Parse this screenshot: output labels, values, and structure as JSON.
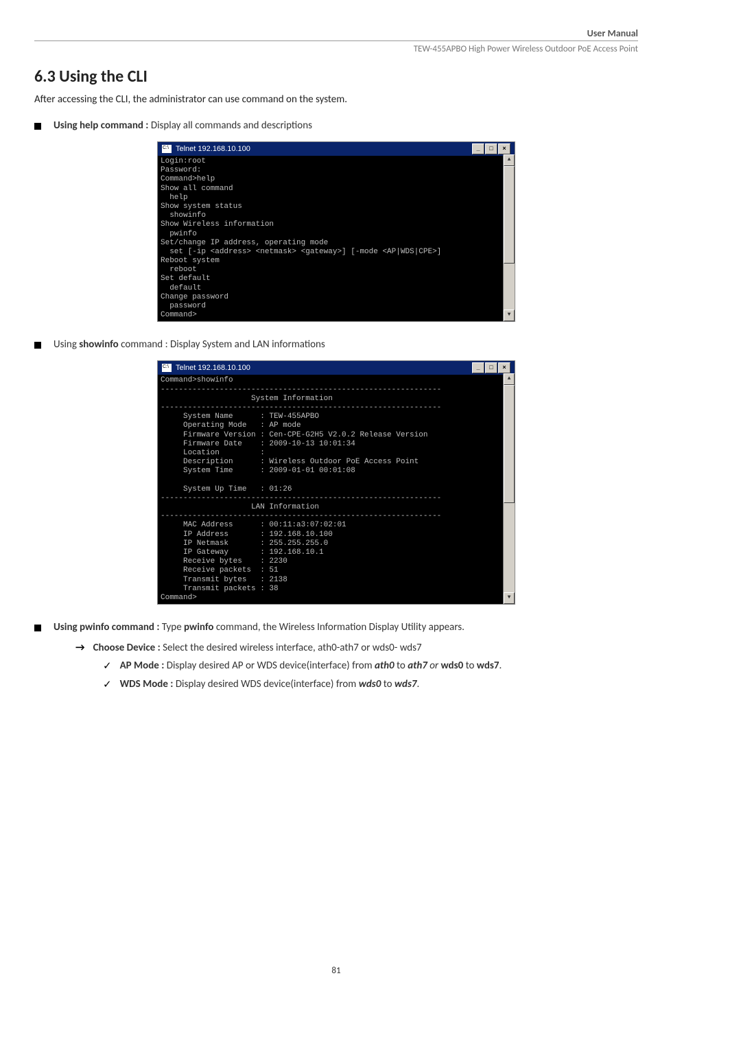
{
  "header": {
    "label": "User Manual",
    "subtitle": "TEW-455APBO High Power Wireless Outdoor PoE Access Point"
  },
  "section": {
    "number_title": "6.3 Using the CLI",
    "intro": "After accessing the CLI, the administrator can use command on the system."
  },
  "bullets": [
    {
      "bold": "Using help command :",
      "rest": " Display all commands and descriptions"
    },
    {
      "pre": "Using ",
      "bold": "showinfo",
      "rest": " command : Display System and LAN informations"
    },
    {
      "bold": "Using pwinfo command :",
      "mid": " Type ",
      "bold2": "pwinfo",
      "rest": " command, the Wireless Information Display Utility appears."
    }
  ],
  "arrow": {
    "bold": "Choose Device :",
    "rest": " Select the desired wireless interface, ath0-ath7 or wds0- wds7"
  },
  "checks": [
    {
      "bold": "AP Mode :",
      "t1": " Display desired AP or WDS device(interface) from ",
      "i1": "ath0",
      "t2": " to ",
      "i2": "ath7",
      "t3": " or ",
      "b2": "wds0",
      "t4": " to ",
      "b3": "wds7",
      "t5": "."
    },
    {
      "bold": "WDS Mode :",
      "t1": " Display desired WDS device(interface) from ",
      "i1": "wds0",
      "t2": " to ",
      "i2": "wds7",
      "t3": "."
    }
  ],
  "terminal1": {
    "title": "Telnet 192.168.10.100",
    "body": "Login:root\nPassword:\nCommand>help\nShow all command\n  help\nShow system status\n  showinfo\nShow Wireless information\n  pwinfo\nSet/change IP address, operating mode\n  set [-ip <address> <netmask> <gateway>] [-mode <AP|WDS|CPE>]\nReboot system\n  reboot\nSet default\n  default\nChange password\n  password\nCommand>"
  },
  "terminal2": {
    "title": "Telnet 192.168.10.100",
    "body": "Command>showinfo\n--------------------------------------------------------------\n                    System Information\n--------------------------------------------------------------\n     System Name      : TEW-455APBO\n     Operating Mode   : AP mode\n     Firmware Version : Cen-CPE-G2H5 V2.0.2 Release Version\n     Firmware Date    : 2009-10-13 10:01:34\n     Location         :\n     Description      : Wireless Outdoor PoE Access Point\n     System Time      : 2009-01-01 00:01:08\n\n     System Up Time   : 01:26\n--------------------------------------------------------------\n                    LAN Information\n--------------------------------------------------------------\n     MAC Address      : 00:11:a3:07:02:01\n     IP Address       : 192.168.10.100\n     IP Netmask       : 255.255.255.0\n     IP Gateway       : 192.168.10.1\n     Receive bytes    : 2230\n     Receive packets  : 51\n     Transmit bytes   : 2138\n     Transmit packets : 38\nCommand>"
  },
  "win_buttons": {
    "min": "_",
    "max": "□",
    "close": "×"
  },
  "scroll": {
    "up": "▲",
    "down": "▼"
  },
  "page": "81"
}
